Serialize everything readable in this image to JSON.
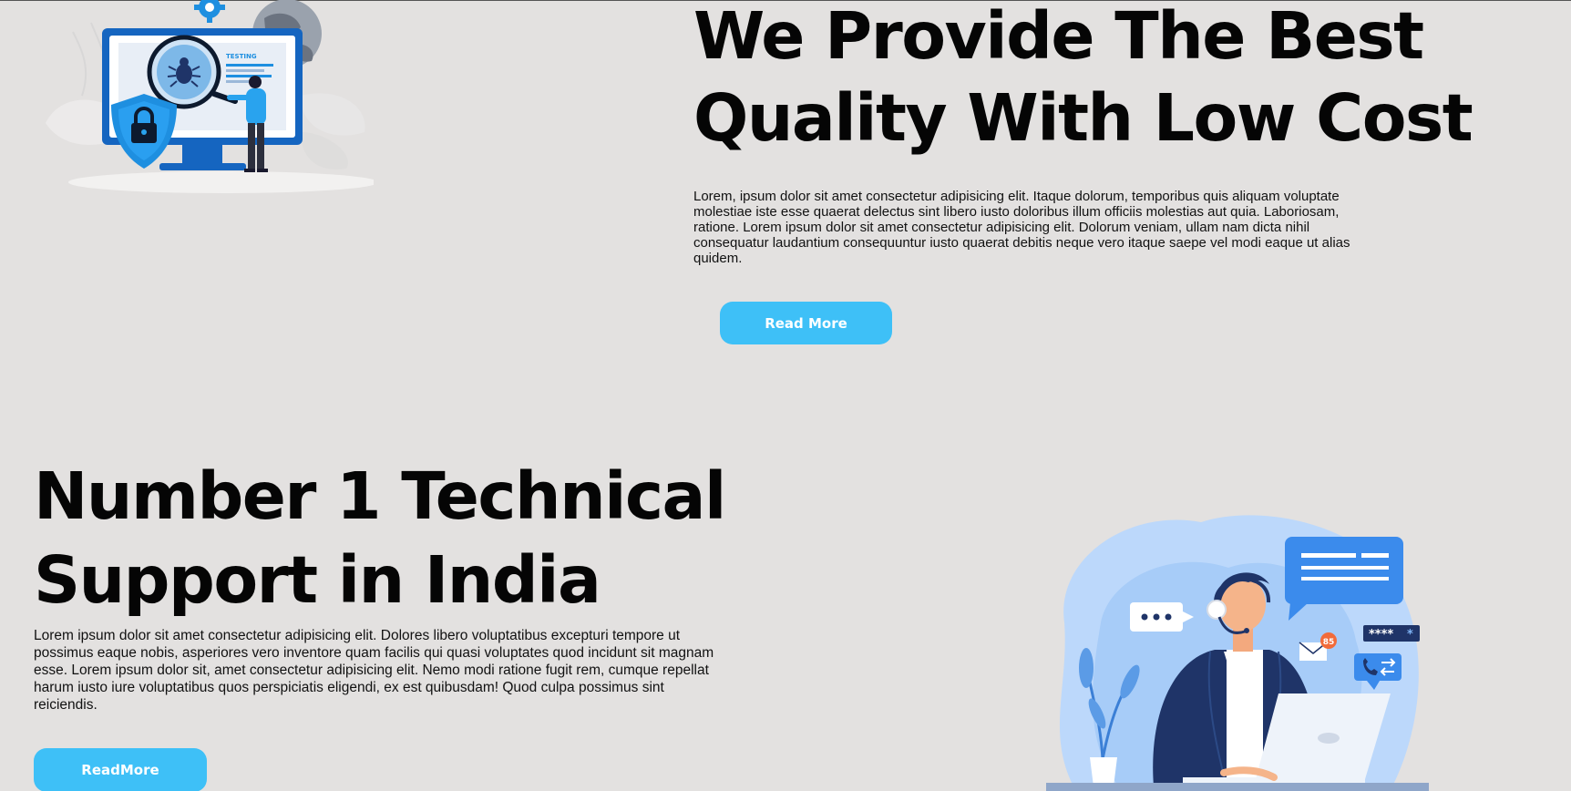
{
  "hero": {
    "title": "We Provide The Best\nQuality With Low Cost",
    "text": "Lorem, ipsum dolor sit amet consectetur adipisicing elit. Itaque dolorum, temporibus quis aliquam voluptate molestiae iste esse quaerat delectus sint libero iusto doloribus illum officiis molestias aut quia. Laboriosam, ratione. Lorem ipsum dolor sit amet consectetur adipisicing elit. Dolorum veniam, ullam nam dicta nihil consequatur laudantium consequuntur iusto quaerat debitis neque vero itaque saepe vel modi eaque ut alias quidem.",
    "button_label": "Read More",
    "illustration": {
      "label": "TESTING",
      "icons": [
        "gear-icon",
        "globe-icon",
        "bug-icon",
        "lock-icon"
      ]
    }
  },
  "support": {
    "title": "Number 1 Technical\nSupport in India",
    "text": "Lorem ipsum dolor sit amet consectetur adipisicing elit. Dolores libero voluptatibus excepturi tempore ut possimus eaque nobis, asperiores vero inventore quam facilis qui quasi voluptates quod incidunt sit magnam esse. Lorem ipsum dolor sit, amet consectetur adipisicing elit. Nemo modi ratione fugit rem, cumque repellat harum iusto iure voluptatibus quos perspiciatis eligendi, ex est quibusdam! Quod culpa possimus sint reiciendis.",
    "button_label": "ReadMore",
    "illustration": {
      "badge_count": "85",
      "password_mask": "****",
      "icons": [
        "chat-bubble-icon",
        "mail-icon",
        "phone-icon",
        "headset-icon",
        "laptop-icon"
      ]
    }
  },
  "colors": {
    "background": "#e3e1e0",
    "accent": "#3ec0f7",
    "illustration_blue": "#1e8fe0",
    "navy": "#1f3468"
  }
}
